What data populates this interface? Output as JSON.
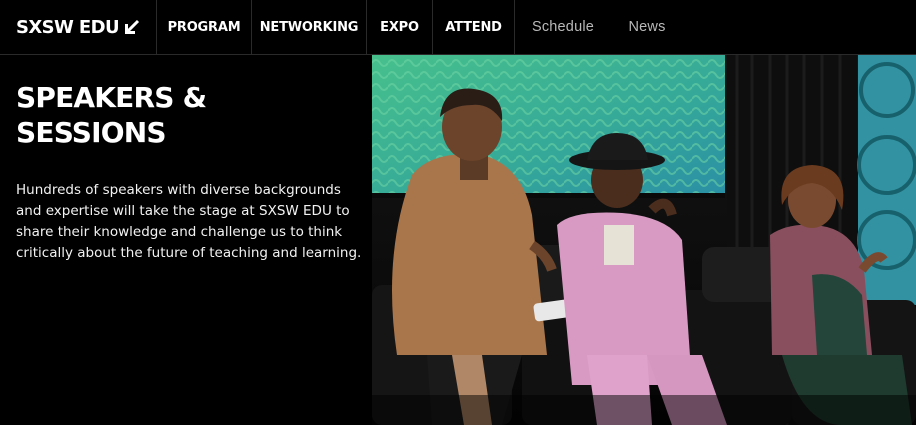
{
  "header": {
    "logo_text": "SXSW EDU",
    "nav": [
      {
        "label": "PROGRAM"
      },
      {
        "label": "NETWORKING"
      },
      {
        "label": "EXPO"
      },
      {
        "label": "ATTEND"
      },
      {
        "label": "Schedule"
      },
      {
        "label": "News"
      }
    ]
  },
  "main": {
    "title": "SPEAKERS & SESSIONS",
    "description": "Hundreds of speakers with diverse backgrounds and expertise will take the stage at SXSW EDU to share their knowledge and challenge us to think critically about the future of teaching and learning."
  },
  "colors": {
    "background": "#000000",
    "screen_green": "#3fb68a",
    "screen_teal": "#2a97a8"
  },
  "icons": {
    "logo_arrow": "arrow-down-left-icon"
  }
}
